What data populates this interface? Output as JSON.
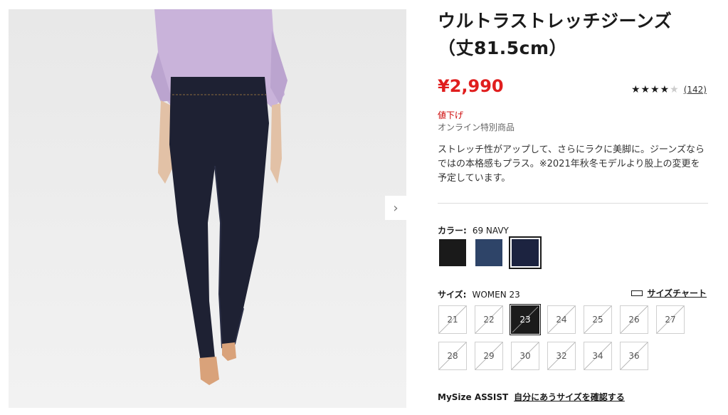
{
  "product": {
    "title": "ウルトラストレッチジーンズ（丈81.5cm）",
    "price": "¥2,990",
    "rating": {
      "stars_filled": 4,
      "stars_total": 5,
      "count": "(142)"
    },
    "badge": "値下げ",
    "online_label": "オンライン特別商品",
    "description": "ストレッチ性がアップして、さらにラクに美脚に。ジーンズならではの本格感もプラス。※2021年秋冬モデルより股上の変更を予定しています。"
  },
  "gallery": {
    "next_icon": "›"
  },
  "color": {
    "label": "カラー:",
    "selected": "69 NAVY",
    "swatches": [
      {
        "name": "black",
        "hex": "#1a1a1a"
      },
      {
        "name": "blue",
        "hex": "#2e4468"
      },
      {
        "name": "navy",
        "hex": "#1c2340"
      }
    ],
    "selected_index": 2
  },
  "size": {
    "label": "サイズ:",
    "selected": "WOMEN 23",
    "chart_link": "サイズチャート",
    "options": [
      "21",
      "22",
      "23",
      "24",
      "25",
      "26",
      "27",
      "28",
      "29",
      "30",
      "32",
      "34",
      "36"
    ],
    "selected_index": 2
  },
  "mysize": {
    "label": "MySize ASSIST",
    "link": "自分にあうサイズを確認する"
  }
}
